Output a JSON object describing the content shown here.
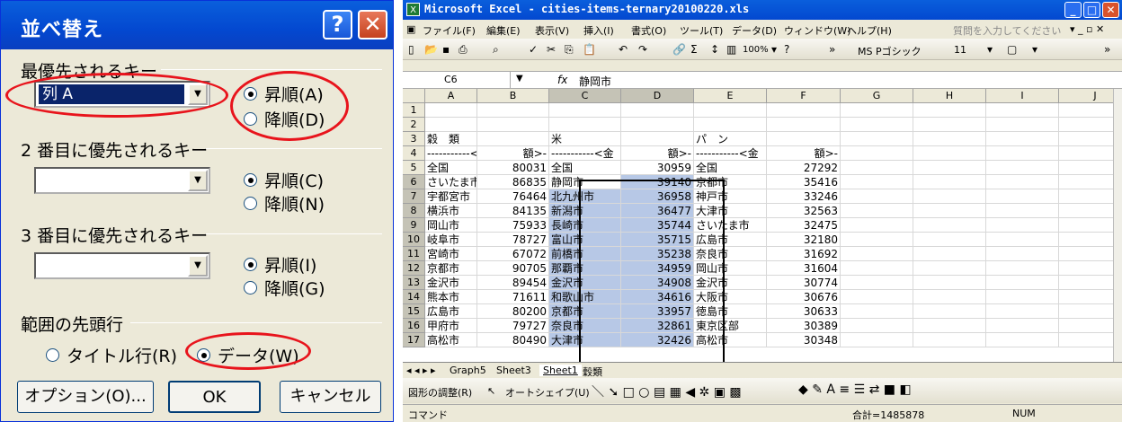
{
  "dialog": {
    "title": "並べ替え",
    "help": "?",
    "close": "✕",
    "key1": {
      "label": "最優先されるキー",
      "value": "列 A",
      "asc": "昇順(A)",
      "desc": "降順(D)",
      "selected": "asc"
    },
    "key2": {
      "label": "2 番目に優先されるキー",
      "value": "",
      "asc": "昇順(C)",
      "desc": "降順(N)",
      "selected": "asc"
    },
    "key3": {
      "label": "3 番目に優先されるキー",
      "value": "",
      "asc": "昇順(I)",
      "desc": "降順(G)",
      "selected": "asc"
    },
    "header": {
      "label": "範囲の先頭行",
      "title_row": "タイトル行(R)",
      "data": "データ(W)",
      "selected": "data"
    },
    "buttons": {
      "options": "オプション(O)...",
      "ok": "OK",
      "cancel": "キャンセル"
    }
  },
  "excel": {
    "title": "Microsoft Excel - cities-items-ternary20100220.xls",
    "menu": [
      "ファイル(F)",
      "編集(E)",
      "表示(V)",
      "挿入(I)",
      "書式(O)",
      "ツール(T)",
      "データ(D)",
      "ウィンドウ(W)",
      "ヘルプ(H)"
    ],
    "help_search": "質問を入力してください",
    "zoom": "100%",
    "font": "MS Pゴシック",
    "font_size": "11",
    "name_box": "C6",
    "fx": "fx",
    "formula": "静岡市",
    "columns": [
      "A",
      "B",
      "C",
      "D",
      "E",
      "F",
      "G",
      "H",
      "I",
      "J"
    ],
    "rows": [
      {
        "n": "1",
        "a": "",
        "b": "",
        "c": "",
        "d": "",
        "e": "",
        "f": ""
      },
      {
        "n": "2",
        "a": "",
        "b": "",
        "c": "",
        "d": "",
        "e": "",
        "f": ""
      },
      {
        "n": "3",
        "a": "穀　類",
        "b": "",
        "c": "米",
        "d": "",
        "e": "パ　ン",
        "f": ""
      },
      {
        "n": "4",
        "a": "-----------<金",
        "b": "額>-",
        "c": "-----------<金",
        "d": "額>-",
        "e": "-----------<金",
        "f": "額>-"
      },
      {
        "n": "5",
        "a": "全国",
        "b": "80031",
        "c": "全国",
        "d": "30959",
        "e": "全国",
        "f": "27292"
      },
      {
        "n": "6",
        "a": "さいたま市",
        "b": "86835",
        "c": "静岡市",
        "d": "39140",
        "e": "京都市",
        "f": "35416"
      },
      {
        "n": "7",
        "a": "宇都宮市",
        "b": "76464",
        "c": "北九州市",
        "d": "36958",
        "e": "神戸市",
        "f": "33246"
      },
      {
        "n": "8",
        "a": "横浜市",
        "b": "84135",
        "c": "新潟市",
        "d": "36477",
        "e": "大津市",
        "f": "32563"
      },
      {
        "n": "9",
        "a": "岡山市",
        "b": "75933",
        "c": "長崎市",
        "d": "35744",
        "e": "さいたま市",
        "f": "32475"
      },
      {
        "n": "10",
        "a": "岐阜市",
        "b": "78727",
        "c": "富山市",
        "d": "35715",
        "e": "広島市",
        "f": "32180"
      },
      {
        "n": "11",
        "a": "宮崎市",
        "b": "67072",
        "c": "前橋市",
        "d": "35238",
        "e": "奈良市",
        "f": "31692"
      },
      {
        "n": "12",
        "a": "京都市",
        "b": "90705",
        "c": "那覇市",
        "d": "34959",
        "e": "岡山市",
        "f": "31604"
      },
      {
        "n": "13",
        "a": "金沢市",
        "b": "89454",
        "c": "金沢市",
        "d": "34908",
        "e": "金沢市",
        "f": "30774"
      },
      {
        "n": "14",
        "a": "熊本市",
        "b": "71611",
        "c": "和歌山市",
        "d": "34616",
        "e": "大阪市",
        "f": "30676"
      },
      {
        "n": "15",
        "a": "広島市",
        "b": "80200",
        "c": "京都市",
        "d": "33957",
        "e": "徳島市",
        "f": "30633"
      },
      {
        "n": "16",
        "a": "甲府市",
        "b": "79727",
        "c": "奈良市",
        "d": "32861",
        "e": "東京区部",
        "f": "30389"
      },
      {
        "n": "17",
        "a": "高松市",
        "b": "80490",
        "c": "大津市",
        "d": "32426",
        "e": "高松市",
        "f": "30348"
      }
    ],
    "sheets": [
      "Graph5",
      "Sheet3",
      "Sheet1",
      "穀類"
    ],
    "active_sheet": "Sheet1",
    "draw_menu": "図形の調整(R)",
    "autoshape": "オートシェイプ(U)",
    "status_left": "コマンド",
    "status_sum": "合計=1485878",
    "status_num": "NUM"
  }
}
